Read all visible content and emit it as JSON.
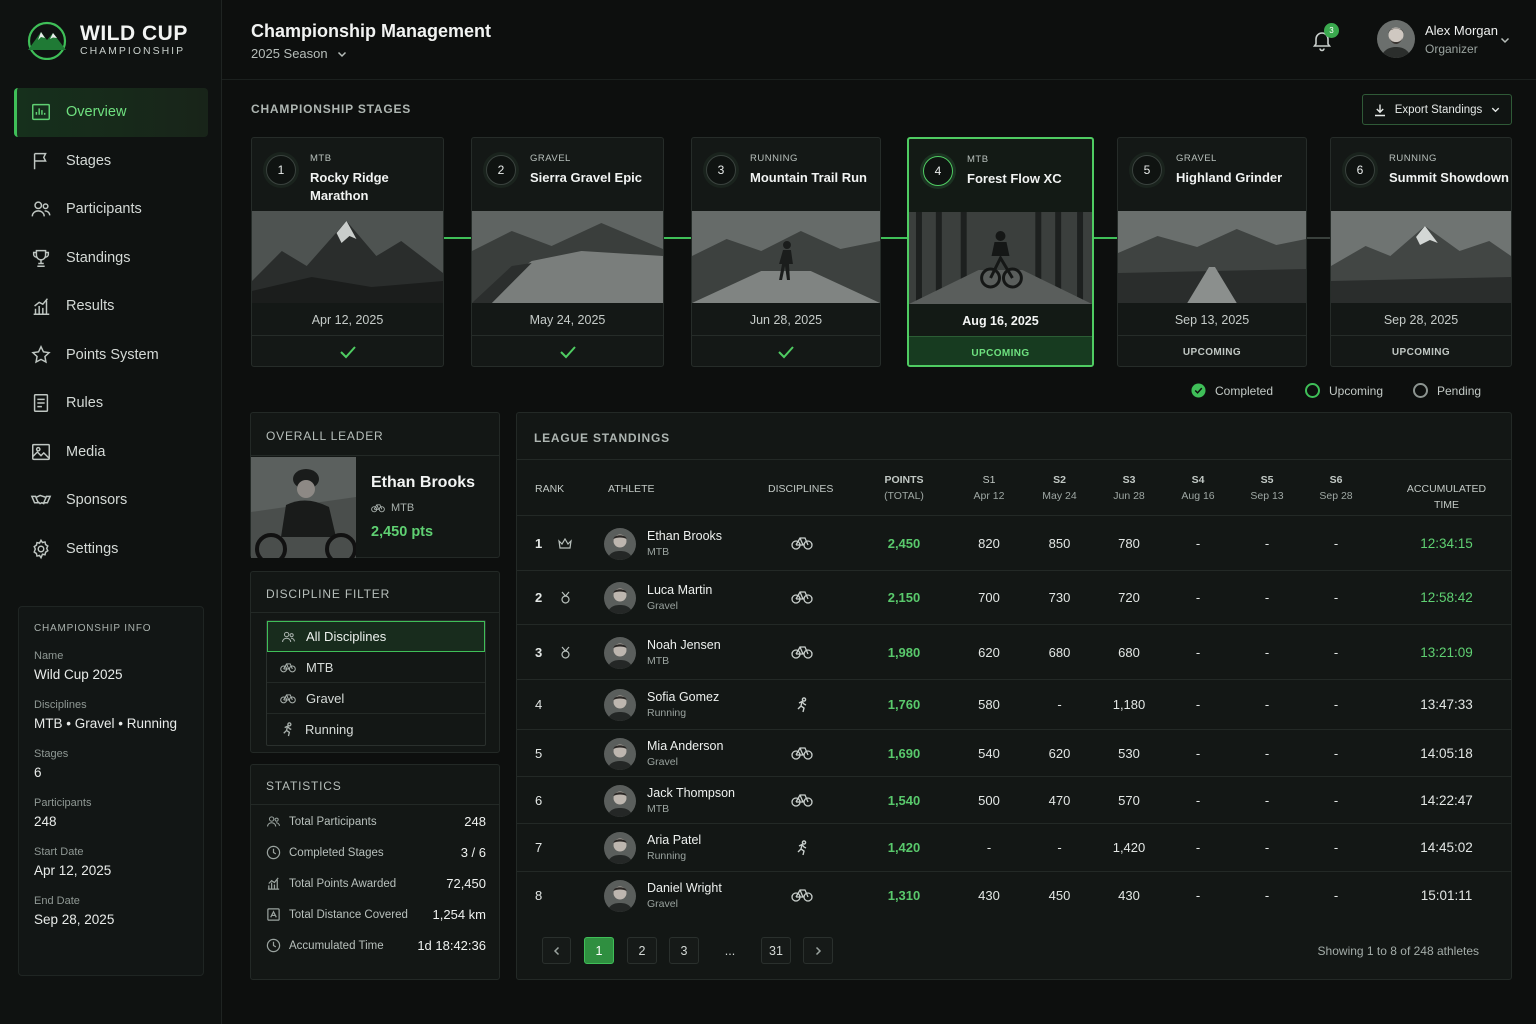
{
  "brand": {
    "name": "WILD CUP",
    "sub": "CHAMPIONSHIP"
  },
  "nav": [
    {
      "label": "Overview",
      "icon": "overview-icon",
      "active": true
    },
    {
      "label": "Stages",
      "icon": "flag-icon"
    },
    {
      "label": "Participants",
      "icon": "users-icon"
    },
    {
      "label": "Standings",
      "icon": "trophy-icon"
    },
    {
      "label": "Results",
      "icon": "bar-chart-icon"
    },
    {
      "label": "Points System",
      "icon": "star-icon"
    },
    {
      "label": "Rules",
      "icon": "document-icon"
    },
    {
      "label": "Media",
      "icon": "image-icon"
    },
    {
      "label": "Sponsors",
      "icon": "handshake-icon"
    },
    {
      "label": "Settings",
      "icon": "gear-icon"
    }
  ],
  "info": {
    "title": "CHAMPIONSHIP INFO",
    "fields": [
      {
        "label": "Name",
        "value": "Wild Cup 2025"
      },
      {
        "label": "Disciplines",
        "value": "MTB • Gravel • Running"
      },
      {
        "label": "Stages",
        "value": "6"
      },
      {
        "label": "Participants",
        "value": "248"
      },
      {
        "label": "Start Date",
        "value": "Apr 12, 2025"
      },
      {
        "label": "End Date",
        "value": "Sep 28, 2025"
      }
    ]
  },
  "header": {
    "title": "Championship Management",
    "season": "2025 Season",
    "notifications": "3",
    "user_name": "Alex Morgan",
    "user_role": "Organizer"
  },
  "stages_section": {
    "title": "CHAMPIONSHIP STAGES",
    "export_label": "Export Standings",
    "stages": [
      {
        "num": "1",
        "disc": "MTB",
        "name": "Rocky Ridge Marathon",
        "date": "Apr 12, 2025",
        "status": "completed",
        "status_label": ""
      },
      {
        "num": "2",
        "disc": "GRAVEL",
        "name": "Sierra Gravel Epic",
        "date": "May 24, 2025",
        "status": "completed",
        "status_label": ""
      },
      {
        "num": "3",
        "disc": "RUNNING",
        "name": "Mountain Trail Run",
        "date": "Jun 28, 2025",
        "status": "completed",
        "status_label": ""
      },
      {
        "num": "4",
        "disc": "MTB",
        "name": "Forest Flow XC",
        "date": "Aug 16, 2025",
        "status": "current",
        "status_label": "UPCOMING"
      },
      {
        "num": "5",
        "disc": "GRAVEL",
        "name": "Highland Grinder",
        "date": "Sep 13, 2025",
        "status": "upcoming",
        "status_label": "UPCOMING"
      },
      {
        "num": "6",
        "disc": "RUNNING",
        "name": "Summit Showdown",
        "date": "Sep 28, 2025",
        "status": "upcoming",
        "status_label": "UPCOMING"
      }
    ],
    "legend": {
      "completed": "Completed",
      "upcoming": "Upcoming",
      "pending": "Pending"
    }
  },
  "leader": {
    "title": "OVERALL LEADER",
    "name": "Ethan Brooks",
    "discipline": "MTB",
    "points": "2,450 pts"
  },
  "filter": {
    "title": "DISCIPLINE FILTER",
    "items": [
      {
        "label": "All Disciplines",
        "icon": "users-icon",
        "active": true
      },
      {
        "label": "MTB",
        "icon": "bike-icon"
      },
      {
        "label": "Gravel",
        "icon": "bike-icon"
      },
      {
        "label": "Running",
        "icon": "runner-icon"
      }
    ]
  },
  "stats": {
    "title": "STATISTICS",
    "rows": [
      {
        "label": "Total Participants",
        "value": "248",
        "icon": "users-icon"
      },
      {
        "label": "Completed Stages",
        "value": "3 / 6",
        "icon": "clock-icon"
      },
      {
        "label": "Total Points Awarded",
        "value": "72,450",
        "icon": "chart-icon"
      },
      {
        "label": "Total Distance Covered",
        "value": "1,254 km",
        "icon": "map-icon"
      },
      {
        "label": "Accumulated Time",
        "value": "1d 18:42:36",
        "icon": "clock-icon"
      }
    ]
  },
  "standings": {
    "title": "LEAGUE STANDINGS",
    "headers": {
      "rank": "RANK",
      "athlete": "ATHLETE",
      "disciplines": "DISCIPLINES",
      "points": "POINTS",
      "points_sub": "(TOTAL)",
      "s1": "S1",
      "s1_sub": "Apr 12",
      "s2": "S2",
      "s2_sub": "May 24",
      "s3": "S3",
      "s3_sub": "Jun 28",
      "s4": "S4",
      "s4_sub": "Aug 16",
      "s5": "S5",
      "s5_sub": "Sep 13",
      "s6": "S6",
      "s6_sub": "Sep 28",
      "time": "ACCUMULATED TIME"
    },
    "rows": [
      {
        "rank": "1",
        "medal": "crown-icon",
        "name": "Ethan Brooks",
        "disc": "MTB",
        "type": "bike",
        "points": "2,450",
        "s1": "820",
        "s2": "850",
        "s3": "780",
        "s4": "-",
        "s5": "-",
        "s6": "-",
        "time": "12:34:15"
      },
      {
        "rank": "2",
        "medal": "medal-icon",
        "name": "Luca Martin",
        "disc": "Gravel",
        "type": "bike",
        "points": "2,150",
        "s1": "700",
        "s2": "730",
        "s3": "720",
        "s4": "-",
        "s5": "-",
        "s6": "-",
        "time": "12:58:42"
      },
      {
        "rank": "3",
        "medal": "medal-icon",
        "name": "Noah Jensen",
        "disc": "MTB",
        "type": "bike",
        "points": "1,980",
        "s1": "620",
        "s2": "680",
        "s3": "680",
        "s4": "-",
        "s5": "-",
        "s6": "-",
        "time": "13:21:09"
      },
      {
        "rank": "4",
        "medal": "",
        "name": "Sofia Gomez",
        "disc": "Running",
        "type": "run",
        "points": "1,760",
        "s1": "580",
        "s2": "-",
        "s3": "1,180",
        "s4": "-",
        "s5": "-",
        "s6": "-",
        "time": "13:47:33"
      },
      {
        "rank": "5",
        "medal": "",
        "name": "Mia Anderson",
        "disc": "Gravel",
        "type": "bike",
        "points": "1,690",
        "s1": "540",
        "s2": "620",
        "s3": "530",
        "s4": "-",
        "s5": "-",
        "s6": "-",
        "time": "14:05:18"
      },
      {
        "rank": "6",
        "medal": "",
        "name": "Jack Thompson",
        "disc": "MTB",
        "type": "bike",
        "points": "1,540",
        "s1": "500",
        "s2": "470",
        "s3": "570",
        "s4": "-",
        "s5": "-",
        "s6": "-",
        "time": "14:22:47"
      },
      {
        "rank": "7",
        "medal": "",
        "name": "Aria Patel",
        "disc": "Running",
        "type": "run",
        "points": "1,420",
        "s1": "-",
        "s2": "-",
        "s3": "1,420",
        "s4": "-",
        "s5": "-",
        "s6": "-",
        "time": "14:45:02"
      },
      {
        "rank": "8",
        "medal": "",
        "name": "Daniel Wright",
        "disc": "Gravel",
        "type": "bike",
        "points": "1,310",
        "s1": "430",
        "s2": "450",
        "s3": "430",
        "s4": "-",
        "s5": "-",
        "s6": "-",
        "time": "15:01:11"
      }
    ],
    "pagination": {
      "pages": [
        "1",
        "2",
        "3",
        "...",
        "31"
      ],
      "current": "1"
    },
    "showing": "Showing 1 to 8 of 248 athletes"
  },
  "colors": {
    "accent": "#3fbf58",
    "accent_text": "#5fd072",
    "bg": "#0d0f0e",
    "panel": "#131715"
  }
}
